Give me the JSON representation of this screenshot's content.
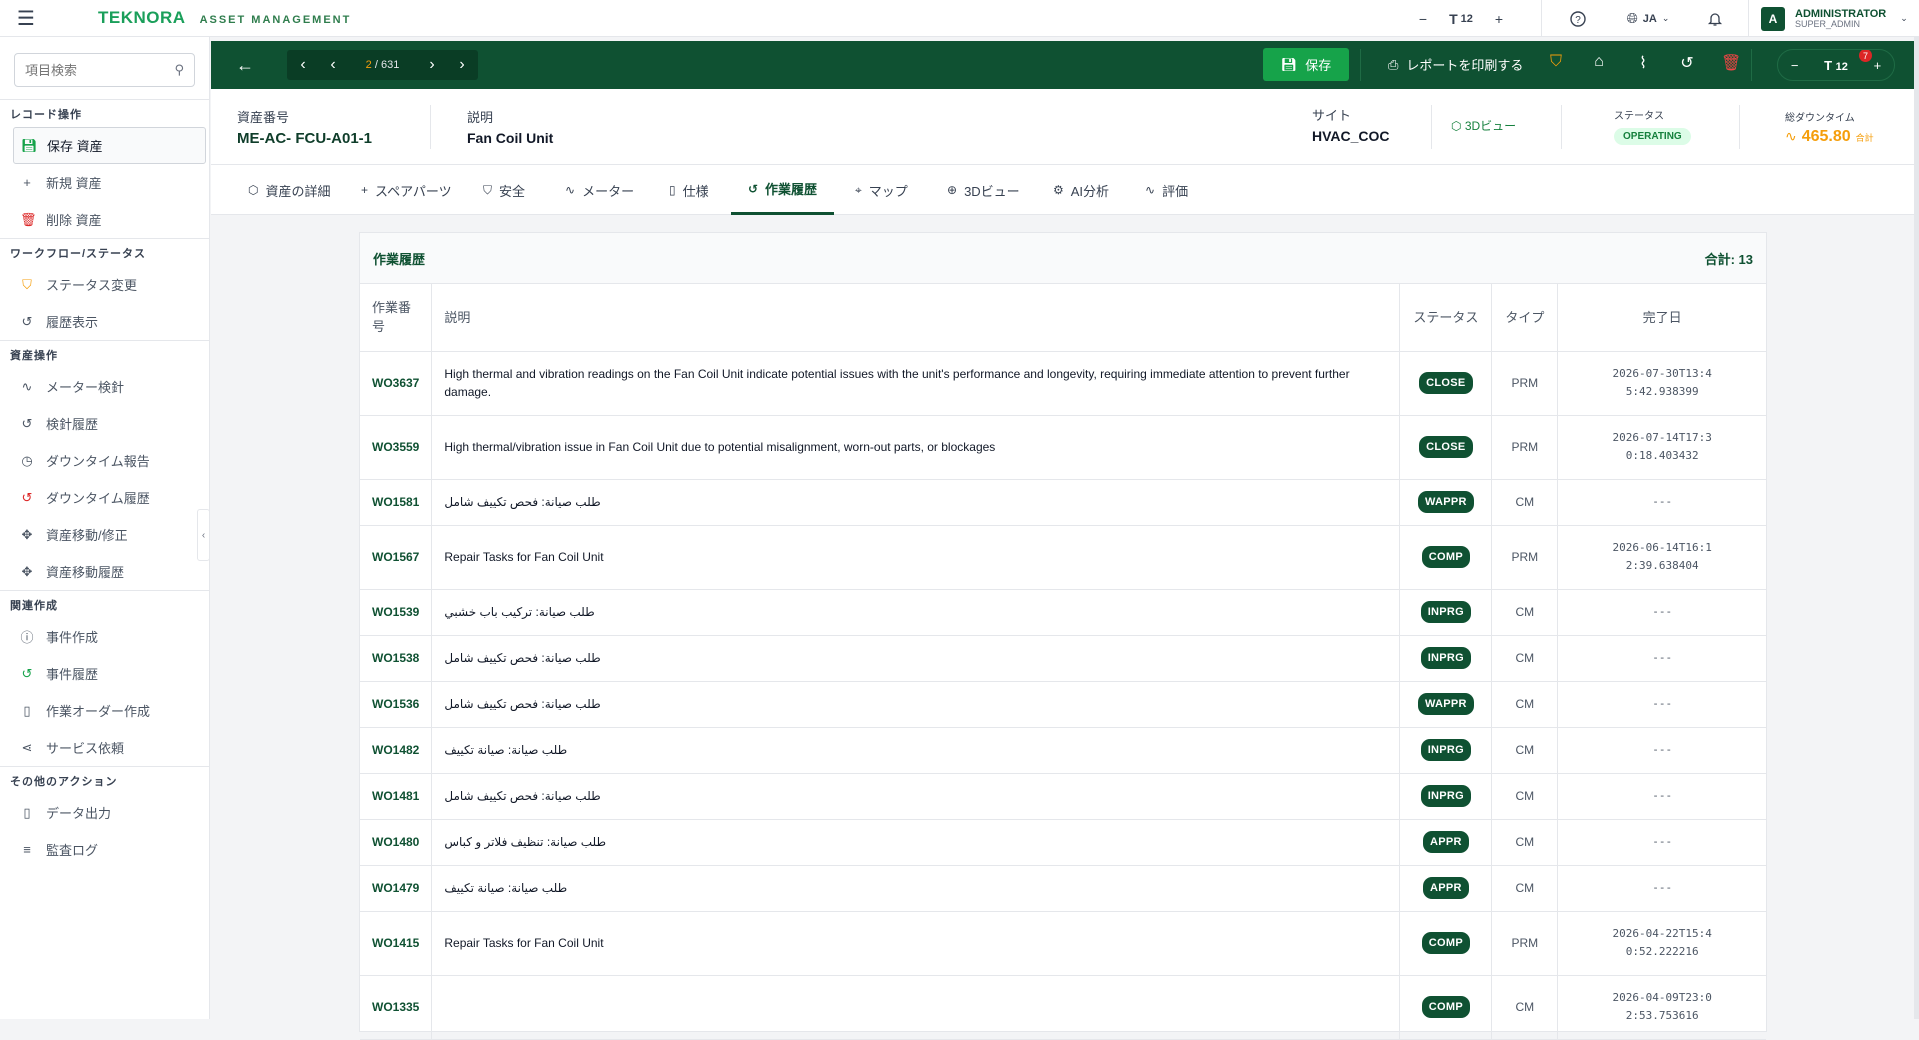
{
  "topbar": {
    "brand": "TEKNORA",
    "brand_sub": "ASSET MANAGEMENT",
    "font_size": "12",
    "lang": "JA",
    "user_name": "ADMINISTRATOR",
    "user_role": "SUPER_ADMIN",
    "avatar_letter": "A"
  },
  "sidebar": {
    "search_placeholder": "項目検索",
    "sections": [
      {
        "title": "レコード操作",
        "items": [
          {
            "icon": "save-icon",
            "label": "保存 資産",
            "active": true
          },
          {
            "icon": "plus-icon",
            "label": "新規 資産"
          },
          {
            "icon": "trash-icon",
            "label": "削除 資産"
          }
        ]
      },
      {
        "title": "ワークフロー/ステータス",
        "items": [
          {
            "icon": "shield-icon",
            "label": "ステータス変更"
          },
          {
            "icon": "history-icon",
            "label": "履歴表示"
          }
        ]
      },
      {
        "title": "資産操作",
        "items": [
          {
            "icon": "activity-icon",
            "label": "メーター検針"
          },
          {
            "icon": "history-icon",
            "label": "検針履歴"
          },
          {
            "icon": "clock-icon",
            "label": "ダウンタイム報告"
          },
          {
            "icon": "history-icon",
            "label": "ダウンタイム履歴"
          },
          {
            "icon": "move-icon",
            "label": "資産移動/修正"
          },
          {
            "icon": "move-icon",
            "label": "資産移動履歴"
          }
        ]
      },
      {
        "title": "関連作成",
        "items": [
          {
            "icon": "alert-icon",
            "label": "事件作成"
          },
          {
            "icon": "history-icon",
            "label": "事件履歴"
          },
          {
            "icon": "document-icon",
            "label": "作業オーダー作成"
          },
          {
            "icon": "share-icon",
            "label": "サービス依頼"
          }
        ]
      },
      {
        "title": "その他のアクション",
        "items": [
          {
            "icon": "document-icon",
            "label": "データ出力"
          },
          {
            "icon": "list-icon",
            "label": "監査ログ"
          }
        ]
      }
    ]
  },
  "toolbar": {
    "page_current": "2",
    "page_total": "631",
    "save_label": "保存",
    "print_label": "レポートを印刷する",
    "attachment_count": "7",
    "font_size": "12"
  },
  "asset": {
    "number_label": "資産番号",
    "number": "ME-AC- FCU-A01-1",
    "desc_label": "説明",
    "desc": "Fan Coil Unit",
    "site_label": "サイト",
    "site": "HVAC_COC",
    "view3d": "3Dビュー",
    "status_label": "ステータス",
    "status": "OPERATING",
    "downtime_label": "総ダウンタイム",
    "downtime": "465.80",
    "downtime_unit": "合計"
  },
  "tabs": [
    {
      "icon": "cube-icon",
      "label": "資産の詳細"
    },
    {
      "icon": "plus-icon",
      "label": "スペアパーツ"
    },
    {
      "icon": "shield-icon",
      "label": "安全"
    },
    {
      "icon": "activity-icon",
      "label": "メーター"
    },
    {
      "icon": "document-icon",
      "label": "仕様"
    },
    {
      "icon": "history-icon",
      "label": "作業履歴",
      "active": true
    },
    {
      "icon": "pin-icon",
      "label": "マップ"
    },
    {
      "icon": "globe-icon",
      "label": "3Dビュー"
    },
    {
      "icon": "ai-icon",
      "label": "AI分析"
    },
    {
      "icon": "activity-icon",
      "label": "評価"
    }
  ],
  "workhistory": {
    "title": "作業履歴",
    "total": "合計: 13",
    "columns": [
      "作業番号",
      "説明",
      "ステータス",
      "タイプ",
      "完了日"
    ],
    "rows": [
      {
        "wo": "WO3637",
        "desc": "High thermal and vibration readings on the Fan Coil Unit indicate potential issues with the unit's performance and longevity, requiring immediate attention to prevent further damage.",
        "status": "CLOSE",
        "type": "PRM",
        "date": "2026-07-30T13:45:42.938399"
      },
      {
        "wo": "WO3559",
        "desc": "High thermal/vibration issue in Fan Coil Unit due to potential misalignment, worn-out parts, or blockages",
        "status": "CLOSE",
        "type": "PRM",
        "date": "2026-07-14T17:30:18.403432"
      },
      {
        "wo": "WO1581",
        "desc": "طلب صيانة: فحص تكييف شامل",
        "status": "WAPPR",
        "type": "CM",
        "date": "---",
        "rtl": true
      },
      {
        "wo": "WO1567",
        "desc": "Repair Tasks for Fan Coil Unit",
        "status": "COMP",
        "type": "PRM",
        "date": "2026-06-14T16:12:39.638404"
      },
      {
        "wo": "WO1539",
        "desc": "طلب صيانة: تركيب باب خشبي",
        "status": "INPRG",
        "type": "CM",
        "date": "---",
        "rtl": true
      },
      {
        "wo": "WO1538",
        "desc": "طلب صيانة: فحص تكييف شامل",
        "status": "INPRG",
        "type": "CM",
        "date": "---",
        "rtl": true
      },
      {
        "wo": "WO1536",
        "desc": "طلب صيانة: فحص تكييف شامل",
        "status": "WAPPR",
        "type": "CM",
        "date": "---",
        "rtl": true
      },
      {
        "wo": "WO1482",
        "desc": "طلب صيانة: صيانة تكييف",
        "status": "INPRG",
        "type": "CM",
        "date": "---",
        "rtl": true
      },
      {
        "wo": "WO1481",
        "desc": "طلب صيانة: فحص تكييف شامل",
        "status": "INPRG",
        "type": "CM",
        "date": "---",
        "rtl": true
      },
      {
        "wo": "WO1480",
        "desc": "طلب صيانة: تنظيف فلاتر و كباس",
        "status": "APPR",
        "type": "CM",
        "date": "---",
        "rtl": true
      },
      {
        "wo": "WO1479",
        "desc": "طلب صيانة: صيانة تكييف",
        "status": "APPR",
        "type": "CM",
        "date": "---",
        "rtl": true
      },
      {
        "wo": "WO1415",
        "desc": "Repair Tasks for Fan Coil Unit",
        "status": "COMP",
        "type": "PRM",
        "date": "2026-04-22T15:40:52.222216"
      },
      {
        "wo": "WO1335",
        "desc": "",
        "status": "COMP",
        "type": "CM",
        "date": "2026-04-09T23:02:53.753616"
      }
    ]
  }
}
